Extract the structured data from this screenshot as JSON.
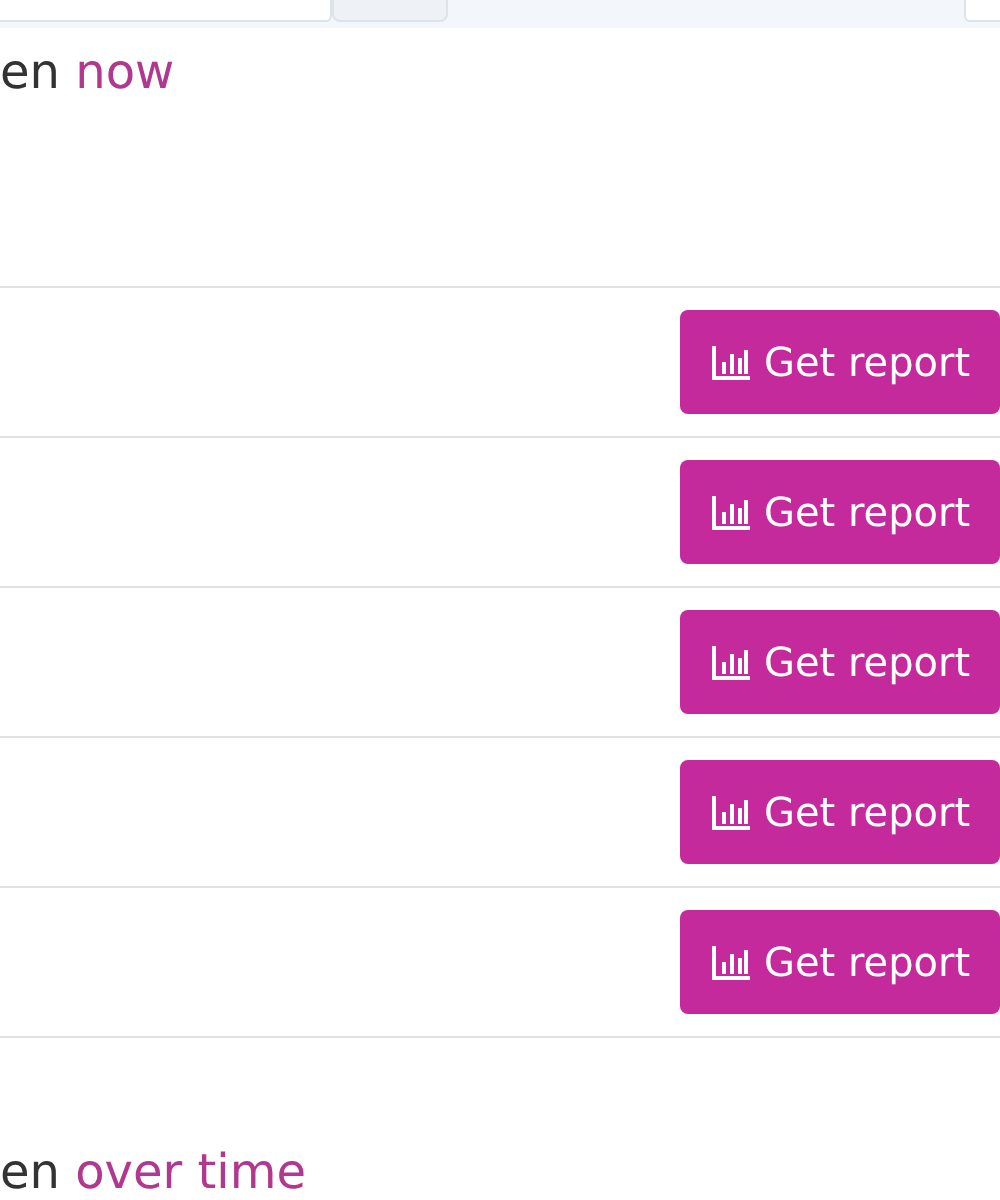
{
  "top_bar": {
    "fields": [
      {
        "kind": "field"
      },
      {
        "kind": "button"
      },
      {
        "kind": "field"
      }
    ]
  },
  "sections": [
    {
      "heading": {
        "text": "en",
        "accent": "now"
      },
      "rows": [
        {
          "button": "Get report"
        },
        {
          "button": "Get report"
        },
        {
          "button": "Get report"
        },
        {
          "button": "Get report"
        },
        {
          "button": "Get report"
        }
      ]
    },
    {
      "heading": {
        "text": "en",
        "accent": "over time"
      }
    }
  ]
}
